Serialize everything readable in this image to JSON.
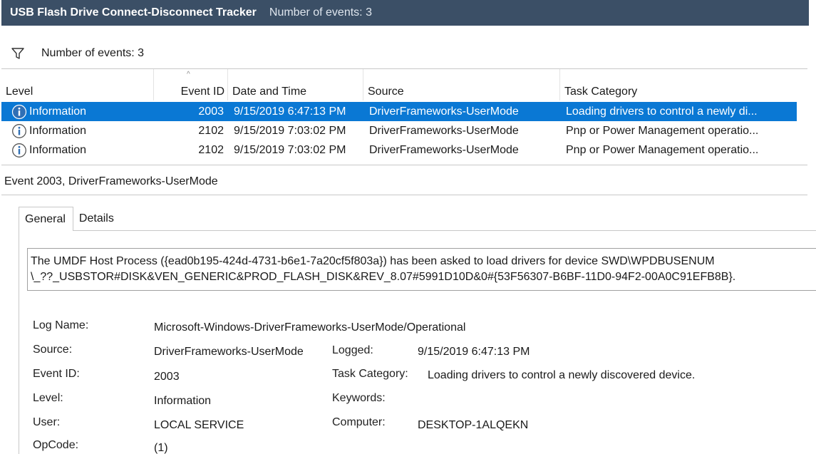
{
  "window": {
    "title": "USB Flash Drive Connect-Disconnect Tracker",
    "subtitle": "Number of events: 3"
  },
  "filter": {
    "icon": "filter-icon",
    "label": "Number of events: 3"
  },
  "grid": {
    "columns": [
      "Level",
      "Event ID",
      "Date and Time",
      "Source",
      "Task Category"
    ],
    "sort_glyph": "^",
    "rows": [
      {
        "level": "Information",
        "event_id": "2003",
        "date_time": "9/15/2019 6:47:13 PM",
        "source": "DriverFrameworks-UserMode",
        "task_category": "Loading drivers to control a newly di...",
        "selected": true
      },
      {
        "level": "Information",
        "event_id": "2102",
        "date_time": "9/15/2019 7:03:02 PM",
        "source": "DriverFrameworks-UserMode",
        "task_category": "Pnp or Power Management operatio...",
        "selected": false
      },
      {
        "level": "Information",
        "event_id": "2102",
        "date_time": "9/15/2019 7:03:02 PM",
        "source": "DriverFrameworks-UserMode",
        "task_category": "Pnp or Power Management operatio...",
        "selected": false
      }
    ]
  },
  "detail": {
    "header": "Event 2003, DriverFrameworks-UserMode",
    "tabs": [
      "General",
      "Details"
    ],
    "message_line1": "The UMDF Host Process ({ead0b195-424d-4731-b6e1-7a20cf5f803a}) has been asked to load drivers for device SWD\\WPDBUSENUM",
    "message_line2": "\\_??_USBSTOR#DISK&VEN_GENERIC&PROD_FLASH_DISK&REV_8.07#5991D10D&0#{53F56307-B6BF-11D0-94F2-00A0C91EFB8B}.",
    "fields": {
      "log_name_label": "Log Name:",
      "log_name": "Microsoft-Windows-DriverFrameworks-UserMode/Operational",
      "source_label": "Source:",
      "source": "DriverFrameworks-UserMode",
      "logged_label": "Logged:",
      "logged": "9/15/2019 6:47:13 PM",
      "event_id_label": "Event ID:",
      "event_id": "2003",
      "task_category_label": "Task Category:",
      "task_category": "Loading drivers to control a newly discovered device.",
      "level_label": "Level:",
      "level": "Information",
      "keywords_label": "Keywords:",
      "user_label": "User:",
      "user": "LOCAL SERVICE",
      "computer_label": "Computer:",
      "computer": "DESKTOP-1ALQEKN",
      "opcode_label": "OpCode:",
      "opcode": "(1)"
    }
  },
  "colors": {
    "titlebar": "#3b4f66",
    "selection": "#0a78d4",
    "info_icon": "#2f6fb5"
  }
}
